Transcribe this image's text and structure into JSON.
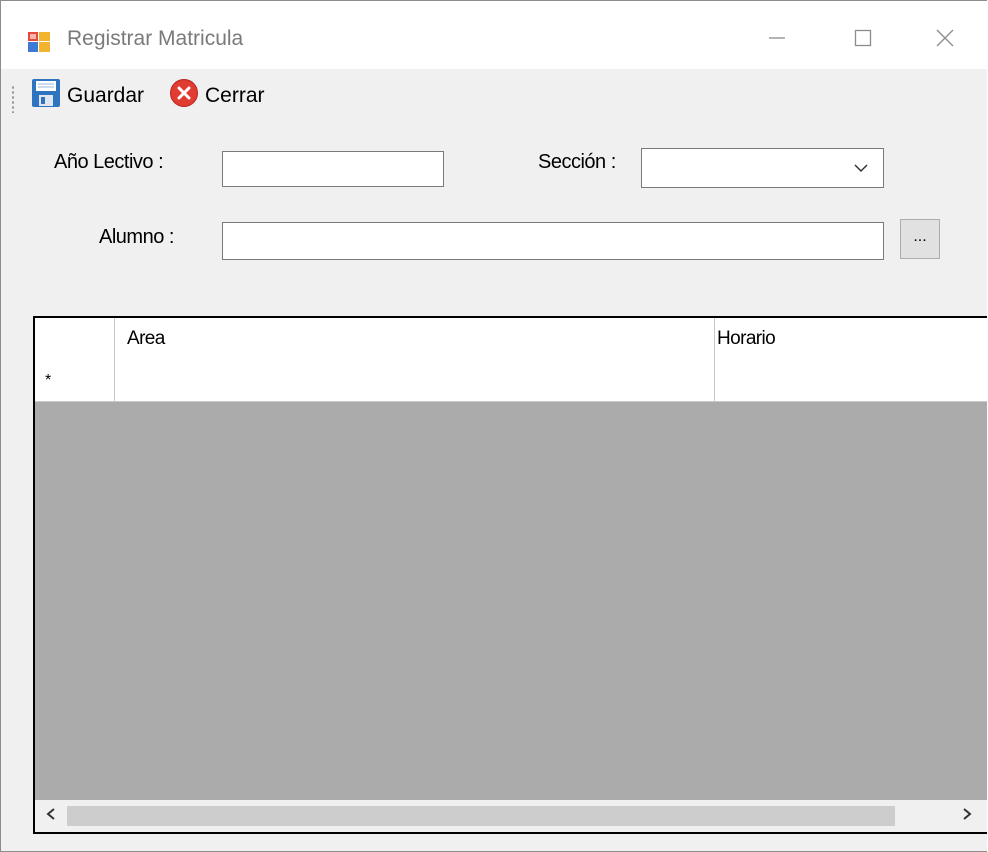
{
  "window": {
    "title": "Registrar Matricula",
    "icon": "form-app-icon",
    "controls": [
      "minimize-icon",
      "maximize-icon",
      "close-icon"
    ]
  },
  "toolbar": {
    "save_label": "Guardar",
    "save_icon": "floppy-disk-icon",
    "close_label": "Cerrar",
    "close_icon": "red-x-circle-icon"
  },
  "form": {
    "year_label": "Año Lectivo :",
    "year_value": "",
    "section_label": "Sección :",
    "section_value": "",
    "student_label": "Alumno :",
    "student_value": "",
    "browse_label": "..."
  },
  "grid": {
    "columns": [
      "Area",
      "Horario"
    ],
    "new_row_marker": "*",
    "rows": []
  },
  "colors": {
    "window_bg": "#f0f0f0",
    "grid_bg": "#ababab",
    "accent_red": "#e03c31"
  }
}
